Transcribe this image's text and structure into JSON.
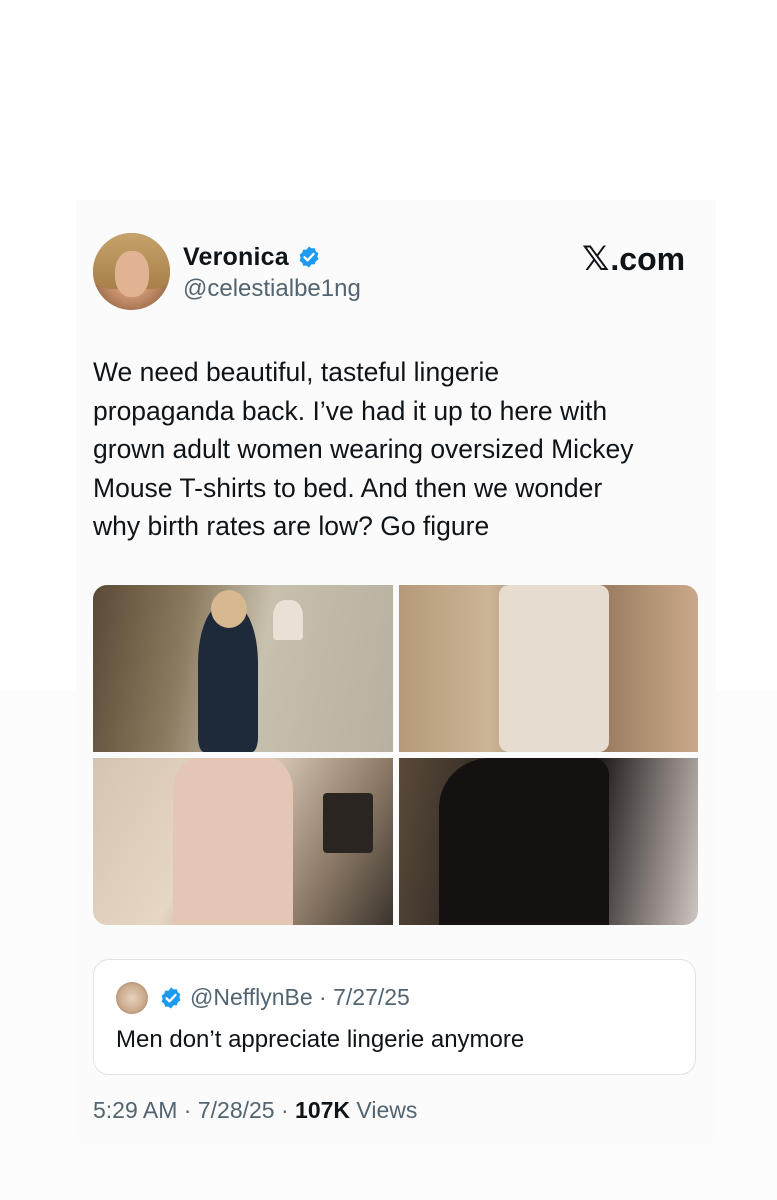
{
  "author": {
    "name": "Veronica",
    "handle": "@celestialbe1ng",
    "verified": true
  },
  "brand": {
    "logo": "𝕏",
    "label": ".com"
  },
  "tweet": {
    "text": "We need beautiful, tasteful lingerie\npropaganda back. I’ve had it up to here with\ngrown adult women wearing oversized Mickey\nMouse T-shirts to bed. And then we wonder\nwhy birth rates are low? Go figure"
  },
  "media": {
    "count": 4
  },
  "quoted_tweet": {
    "handle": "@NefflynBe",
    "separator": "·",
    "date": "7/27/25",
    "text": "Men don’t appreciate lingerie anymore"
  },
  "footer": {
    "time": "5:29 AM",
    "sep1": "·",
    "date": "7/28/25",
    "sep2": "·",
    "views_count": "107K",
    "views_label": "Views"
  },
  "colors": {
    "verified_blue": "#1d9bf0",
    "text_primary": "#0f1419",
    "text_secondary": "#536471"
  }
}
